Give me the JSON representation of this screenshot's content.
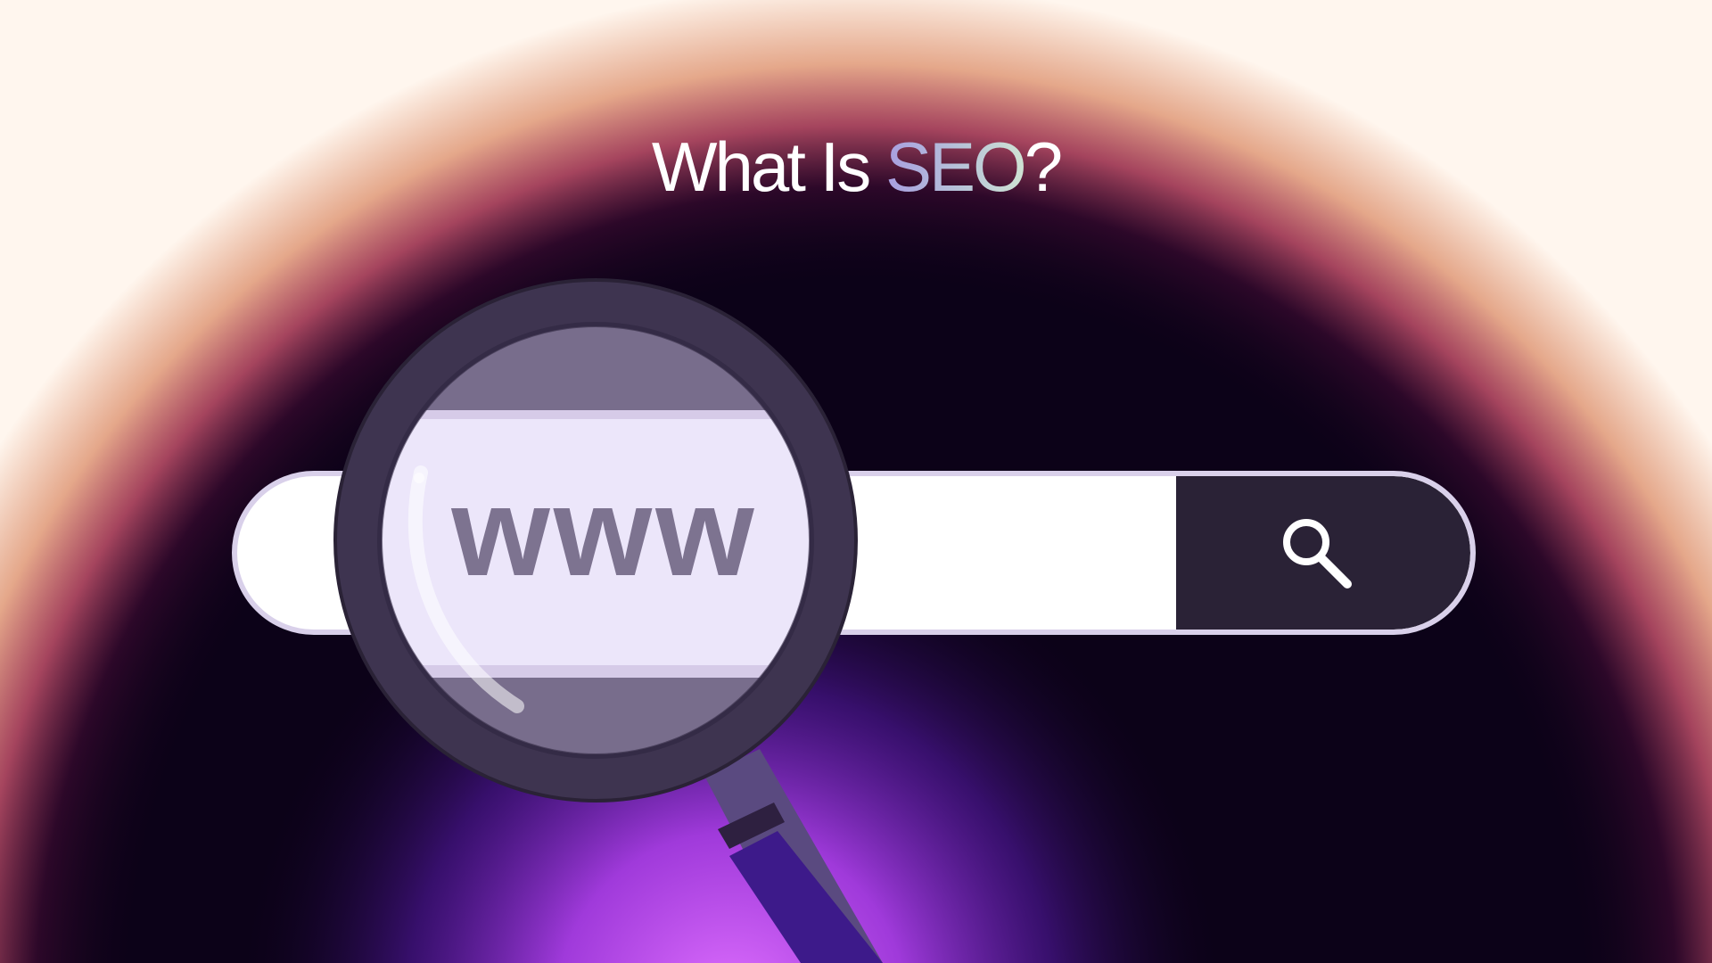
{
  "headline": {
    "prefix": "What Is ",
    "accent": "SEO",
    "suffix": "?"
  },
  "search": {
    "magnified_text": "www",
    "button_icon": "search-icon"
  },
  "illustration": {
    "icon": "magnifying-glass-icon"
  },
  "colors": {
    "background": "#0c0218",
    "search_border": "#d9d0ea",
    "search_button": "#2a2236",
    "lens_fill": "#ece6fa",
    "lens_rim": "#3e3450",
    "magnified_text": "#7d7390",
    "glow_purple": "#b040f0",
    "glow_warm": "#f0b090"
  }
}
